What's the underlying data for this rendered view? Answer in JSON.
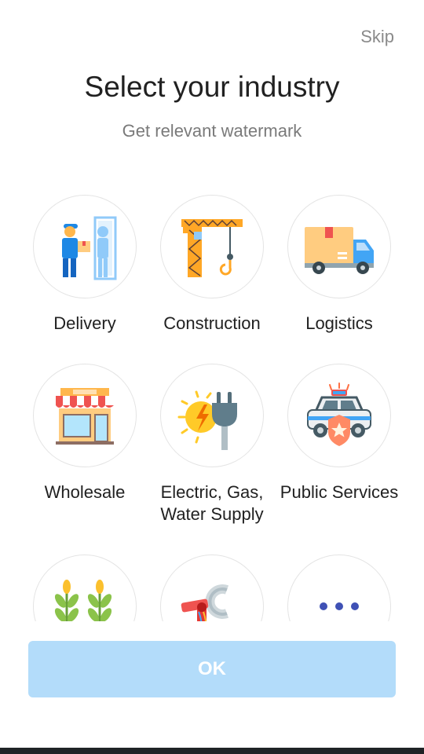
{
  "header": {
    "skip_label": "Skip",
    "title": "Select your industry",
    "subtitle": "Get relevant watermark"
  },
  "industries": [
    {
      "label": "Delivery",
      "icon": "delivery-person-icon"
    },
    {
      "label": "Construction",
      "icon": "crane-icon"
    },
    {
      "label": "Logistics",
      "icon": "truck-icon"
    },
    {
      "label": "Wholesale",
      "icon": "store-icon"
    },
    {
      "label": "Electric, Gas,\nWater Supply",
      "icon": "plug-icon"
    },
    {
      "label": "Public Services",
      "icon": "police-car-icon"
    },
    {
      "label": "",
      "icon": "wheat-icon"
    },
    {
      "label": "",
      "icon": "robot-arm-icon"
    },
    {
      "label": "",
      "icon": "more-icon"
    }
  ],
  "footer": {
    "ok_label": "OK"
  },
  "colors": {
    "accent_disabled": "#b3dcfa",
    "circle_border": "#e4e4e4"
  }
}
